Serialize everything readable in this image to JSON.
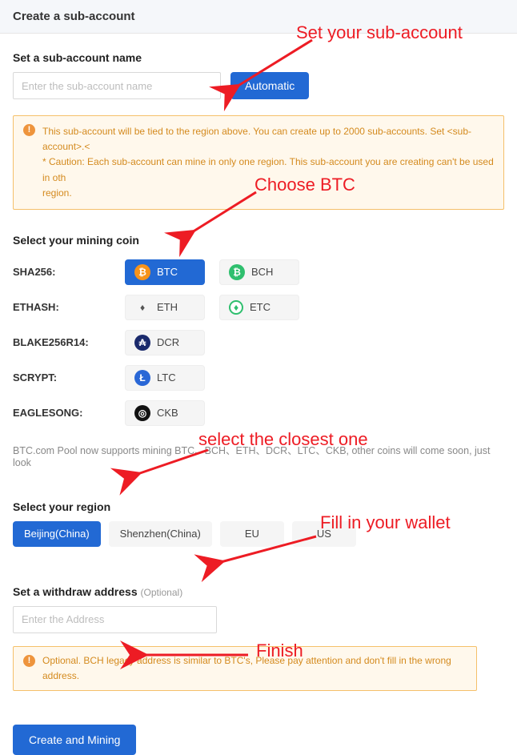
{
  "header": {
    "title": "Create a sub-account"
  },
  "subaccount": {
    "section_label": "Set a sub-account name",
    "placeholder": "Enter the sub-account name",
    "auto_button": "Automatic"
  },
  "alert1": {
    "line1": "This sub-account will be tied to the region above. You can create up to 2000 sub-accounts. Set <sub-account>.<",
    "line2": "* Caution: Each sub-account can mine in only one region. This sub-account you are creating can't be used in oth",
    "line3": "region."
  },
  "coins": {
    "section_label": "Select your mining coin",
    "rows": [
      {
        "algo": "SHA256:",
        "items": [
          {
            "sym": "BTC",
            "selected": true
          },
          {
            "sym": "BCH"
          }
        ]
      },
      {
        "algo": "ETHASH:",
        "items": [
          {
            "sym": "ETH"
          },
          {
            "sym": "ETC"
          }
        ]
      },
      {
        "algo": "BLAKE256R14:",
        "items": [
          {
            "sym": "DCR"
          }
        ]
      },
      {
        "algo": "SCRYPT:",
        "items": [
          {
            "sym": "LTC"
          }
        ]
      },
      {
        "algo": "EAGLESONG:",
        "items": [
          {
            "sym": "CKB"
          }
        ]
      }
    ],
    "support_note": "BTC.com Pool now supports mining BTC、BCH、ETH、DCR、LTC、CKB, other coins will come soon, just look"
  },
  "region": {
    "section_label": "Select your region",
    "items": [
      {
        "label": "Beijing(China)",
        "selected": true
      },
      {
        "label": "Shenzhen(China)"
      },
      {
        "label": "EU"
      },
      {
        "label": "US"
      }
    ]
  },
  "withdraw": {
    "section_label": "Set a withdraw address",
    "optional": "(Optional)",
    "placeholder": "Enter the Address"
  },
  "alert2": {
    "text": "Optional. BCH legacy address is similar to BTC's, Please pay attention and don't fill in the wrong address."
  },
  "create_button": "Create and Mining",
  "annotations": {
    "a1": "Set your sub-account",
    "a2": "Choose BTC",
    "a3": "select the closest one",
    "a4": "Fill in your wallet",
    "a5": "Finish"
  }
}
